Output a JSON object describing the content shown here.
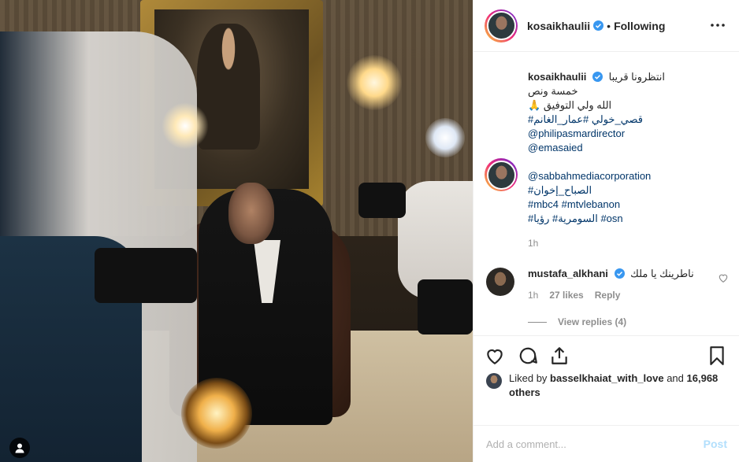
{
  "post": {
    "author": "kosaikhaulii",
    "follow_status": "Following",
    "separator": "•"
  },
  "caption": {
    "username": "kosaikhaulii",
    "lines": [
      "انتظرونا قريبا",
      "خمسة ونص",
      "🙏 الله ولي التوفيق",
      "#قصي_خولي #عمار_الغانم"
    ],
    "mentions_1": [
      "@philipasmardirector",
      "@emasaied"
    ],
    "mentions_2": [
      "@sabbahmediacorporation",
      "#الصباح_إخوان",
      "#mbc4 #mtvlebanon",
      "#السومرية# رؤيا #osn"
    ],
    "time": "1h"
  },
  "comment": {
    "username": "mustafa_alkhani",
    "text": "ناطرينك يا ملك",
    "time": "1h",
    "likes": "27 likes",
    "reply_label": "Reply",
    "view_replies": "View replies (4)"
  },
  "likes": {
    "prefix": "Liked by",
    "liker": "basselkhaiat_with_love",
    "conjunction": "and",
    "others": "16,968 others"
  },
  "add_comment": {
    "placeholder": "Add a comment...",
    "post_label": "Post"
  },
  "colors": {
    "link": "#003569",
    "verified": "#3897f0",
    "muted": "#8e8e8e",
    "post_disabled": "#b2dffc"
  },
  "icons": [
    "verified-badge-icon",
    "more-options-icon",
    "heart-icon",
    "comment-icon",
    "share-icon",
    "bookmark-icon",
    "user-tag-icon"
  ]
}
